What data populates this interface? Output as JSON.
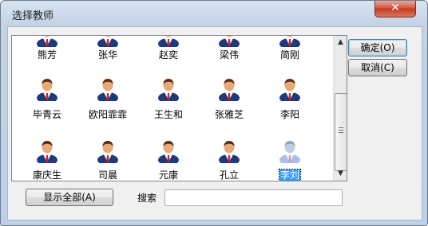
{
  "window": {
    "title": "选择教师",
    "close_glyph": "✕"
  },
  "teachers": [
    {
      "name": "熊芳",
      "icon": "teacher-icon",
      "selected": false
    },
    {
      "name": "张华",
      "icon": "teacher-icon",
      "selected": false
    },
    {
      "name": "赵奕",
      "icon": "teacher-icon",
      "selected": false
    },
    {
      "name": "梁伟",
      "icon": "teacher-icon",
      "selected": false
    },
    {
      "name": "简刚",
      "icon": "teacher-icon",
      "selected": false
    },
    {
      "name": "毕青云",
      "icon": "teacher-icon",
      "selected": false
    },
    {
      "name": "欧阳霏霏",
      "icon": "teacher-icon",
      "selected": false
    },
    {
      "name": "王生和",
      "icon": "teacher-icon",
      "selected": false
    },
    {
      "name": "张雅芝",
      "icon": "teacher-icon",
      "selected": false
    },
    {
      "name": "李阳",
      "icon": "teacher-icon",
      "selected": false
    },
    {
      "name": "康庆生",
      "icon": "teacher-icon",
      "selected": false
    },
    {
      "name": "司晨",
      "icon": "teacher-icon",
      "selected": false
    },
    {
      "name": "元康",
      "icon": "teacher-icon",
      "selected": false
    },
    {
      "name": "孔立",
      "icon": "teacher-icon",
      "selected": false
    },
    {
      "name": "李刘",
      "icon": "teacher-icon",
      "selected": true
    }
  ],
  "buttons": {
    "ok": "确定(O)",
    "cancel": "取消(C)",
    "show_all": "显示全部(A)"
  },
  "search": {
    "label": "搜索",
    "value": ""
  },
  "colors": {
    "selection": "#3399ff",
    "suit": "#1f3a7a",
    "tie": "#d32020"
  }
}
